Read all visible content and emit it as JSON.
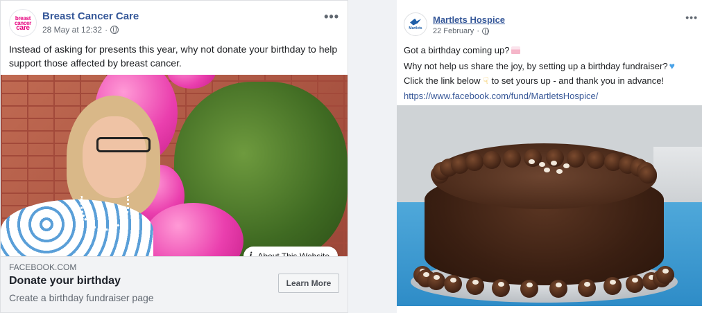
{
  "left_post": {
    "page_name": "Breast Cancer Care",
    "avatar_lines": [
      "breast",
      "cancer",
      "care"
    ],
    "timestamp": "28 May at 12:32",
    "separator": "·",
    "audience_icon": "globe-icon",
    "more_icon": "•••",
    "text": "Instead of asking for presents this year, why not donate your birthday to help support those affected by breast cancer.",
    "about_label": "About This Website",
    "about_icon": "i",
    "link": {
      "domain": "FACEBOOK.COM",
      "headline": "Donate your birthday",
      "description": "Create a birthday fundraiser page",
      "button_label": "Learn More"
    },
    "brand_color": "#e6007e"
  },
  "right_post": {
    "page_name": "Martlets Hospice",
    "avatar_text": "Martlets",
    "timestamp": "22 February",
    "separator": "·",
    "audience_icon": "globe-icon",
    "more_icon": "•••",
    "lines": [
      "Got a birthday coming up?",
      "Why not help us share the joy, by setting up a birthday fundraiser?",
      "Click the link below",
      "to set yours up - and thank you in advance!"
    ],
    "url": "https://www.facebook.com/fund/MartletsHospice/",
    "emojis": [
      "cake-emoji",
      "blue-heart-emoji",
      "pointing-down-emoji"
    ]
  }
}
